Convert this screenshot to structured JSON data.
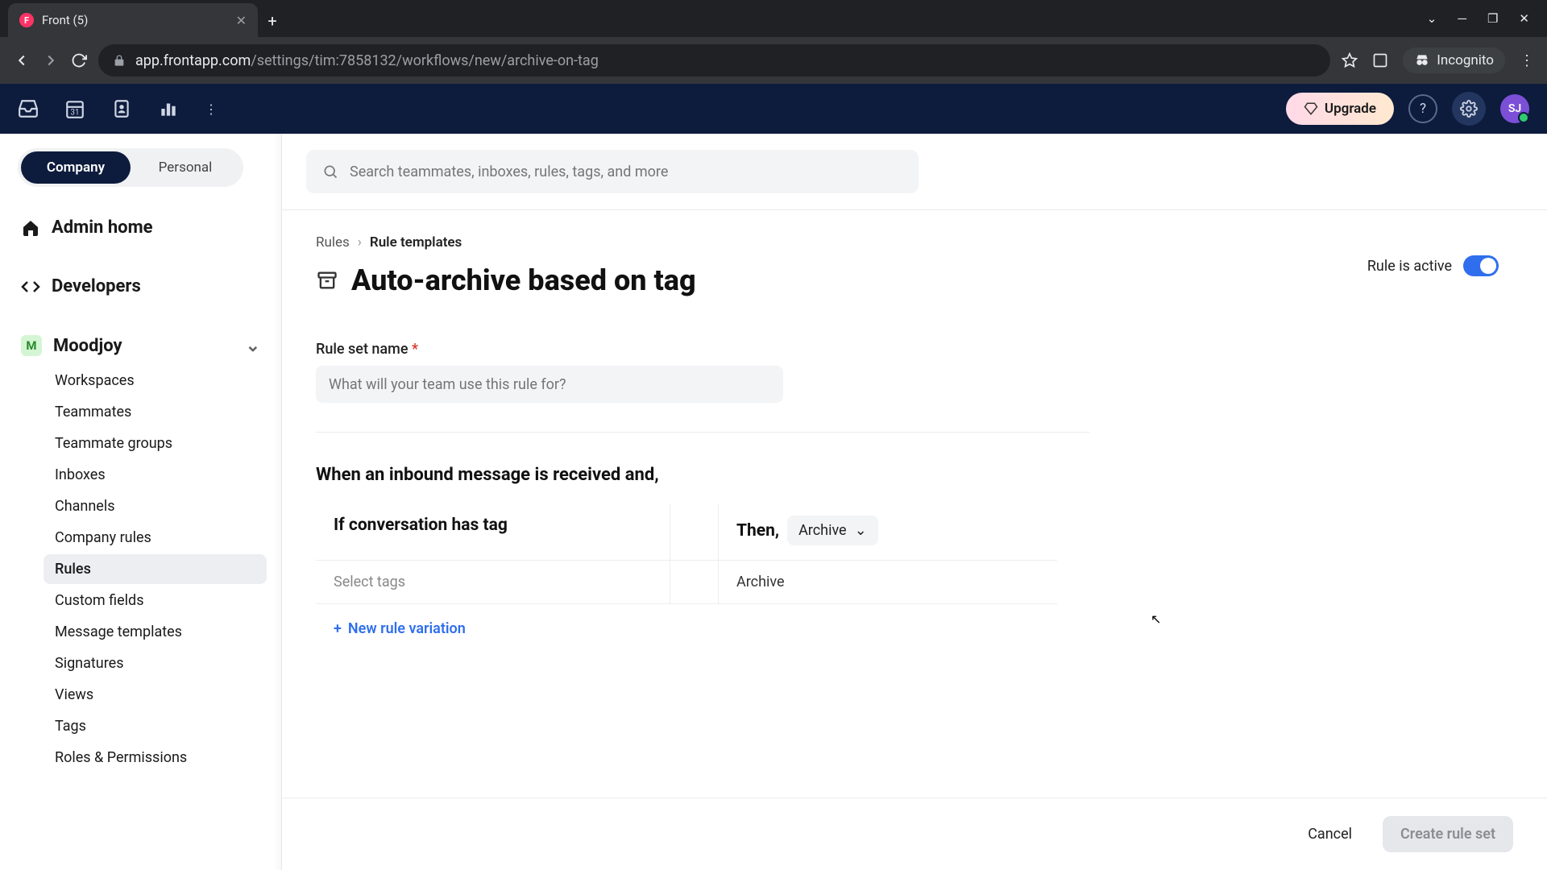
{
  "browser": {
    "tab_title": "Front (5)",
    "url_host": "app.frontapp.com",
    "url_path": "/settings/tim:7858132/workflows/new/archive-on-tag",
    "incognito_label": "Incognito"
  },
  "header": {
    "upgrade_label": "Upgrade",
    "avatar_initials": "SJ"
  },
  "sidebar": {
    "scope": {
      "company": "Company",
      "personal": "Personal"
    },
    "admin_home": "Admin home",
    "developers": "Developers",
    "team": {
      "name": "Moodjoy",
      "badge": "M"
    },
    "items": [
      "Workspaces",
      "Teammates",
      "Teammate groups",
      "Inboxes",
      "Channels",
      "Company rules",
      "Rules",
      "Custom fields",
      "Message templates",
      "Signatures",
      "Views",
      "Tags",
      "Roles & Permissions"
    ],
    "active_index": 6
  },
  "search": {
    "placeholder": "Search teammates, inboxes, rules, tags, and more"
  },
  "breadcrumb": {
    "root": "Rules",
    "leaf": "Rule templates"
  },
  "page": {
    "title": "Auto-archive based on tag",
    "active_label": "Rule is active",
    "rule_name_label": "Rule set name",
    "rule_name_placeholder": "What will your team use this rule for?",
    "when_heading": "When an inbound message is received and,",
    "if_heading": "If conversation has tag",
    "then_heading": "Then,",
    "action_dropdown": "Archive",
    "select_tags_placeholder": "Select tags",
    "action_value": "Archive",
    "new_variation": "New rule variation"
  },
  "footer": {
    "cancel": "Cancel",
    "create": "Create rule set"
  }
}
